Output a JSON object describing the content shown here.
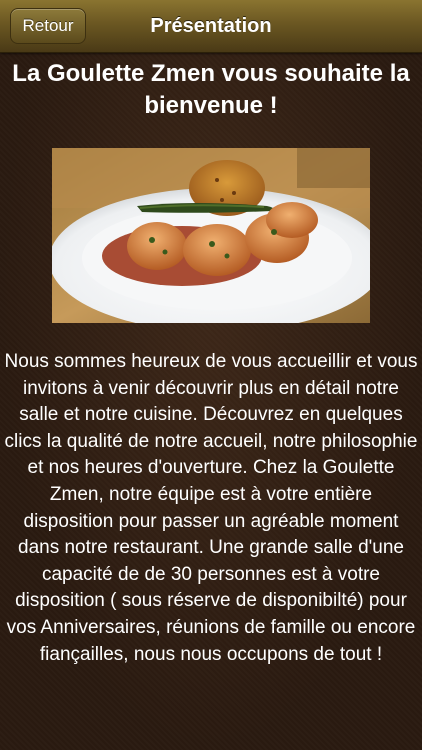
{
  "navbar": {
    "back_label": "Retour",
    "title": "Présentation"
  },
  "main": {
    "heading": "La Goulette Zmen vous souhaite la bienvenue !",
    "photo_icon": "dish-photo",
    "body": "Nous sommes heureux de vous accueillir et vous invitons à venir découvrir plus en détail notre salle et notre cuisine. Découvrez en quelques clics la qualité de notre accueil, notre philosophie et nos heures d'ouverture. Chez la Goulette Zmen, notre équipe est à votre entière disposition pour passer un agréable moment dans notre restaurant. Une grande salle d'une capacité de de 30 personnes est à votre disposition ( sous réserve de disponibilté) pour vos Anniversaires, réunions de famille ou encore fiançailles, nous nous occupons de tout !"
  },
  "colors": {
    "navbar": "#6b5722",
    "background": "#2a1a10",
    "text": "#ffffff"
  }
}
